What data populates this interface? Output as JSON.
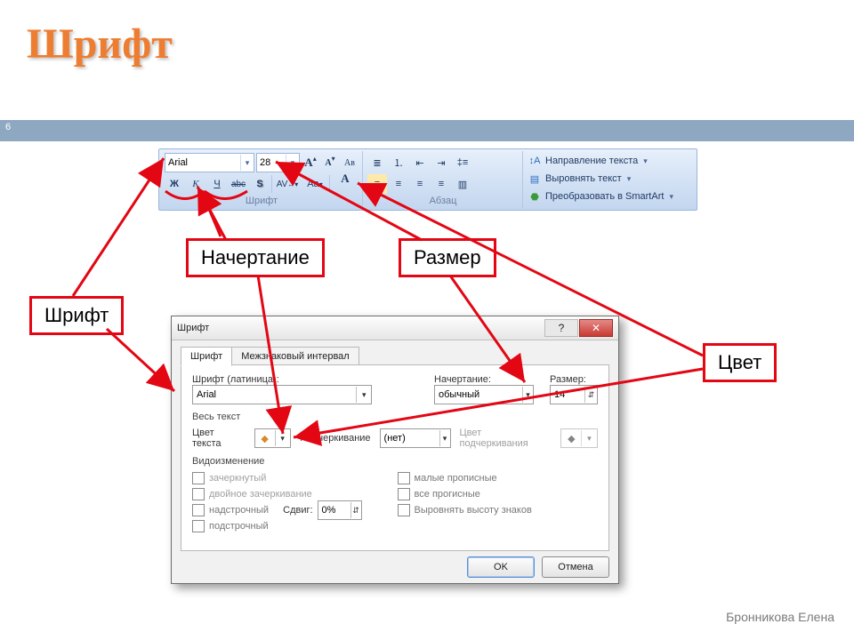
{
  "slide": {
    "title": "Шрифт",
    "page_number": "6",
    "author": "Бронникова Елена"
  },
  "ribbon": {
    "font_group_label": "Шрифт",
    "paragraph_group_label": "Абзац",
    "font_name_value": "Arial",
    "font_size_value": "28",
    "bold_glyph": "Ж",
    "italic_glyph": "К",
    "underline_glyph": "Ч",
    "strike_glyph": "abc",
    "shadow_glyph": "S",
    "spacing_glyph": "AV",
    "case_glyph": "Aa",
    "color_glyph": "A",
    "grow_glyph": "A",
    "shrink_glyph": "A",
    "clear_glyph": "Aʙ",
    "menu": {
      "text_direction": "Направление текста",
      "align_text": "Выровнять текст",
      "smart_art": "Преобразовать в SmartArt"
    }
  },
  "dialog": {
    "title": "Шрифт",
    "tab_font": "Шрифт",
    "tab_spacing": "Межзнаковый интервал",
    "label_font": "Шрифт (латиница):",
    "value_font": "Arial",
    "label_style": "Начертание:",
    "value_style": "обычный",
    "label_size": "Размер:",
    "value_size": "14",
    "section_alltext": "Весь текст",
    "label_text_color": "Цвет текста",
    "label_underline": "Подчеркивание",
    "value_underline": "(нет)",
    "label_underline_color": "Цвет подчеркивания",
    "section_effects": "Видоизменение",
    "effects_left": [
      "зачеркнутый",
      "двойное зачеркивание",
      "надстрочный",
      "подстрочный"
    ],
    "offset_label": "Сдвиг:",
    "offset_value": "0%",
    "effects_right": [
      "малые прописные",
      "все прогисные",
      "Выровнять высоту знаков"
    ],
    "btn_ok": "OK",
    "btn_cancel": "Отмена"
  },
  "callouts": {
    "font": "Шрифт",
    "style": "Начертание",
    "size": "Размер",
    "color": "Цвет"
  }
}
